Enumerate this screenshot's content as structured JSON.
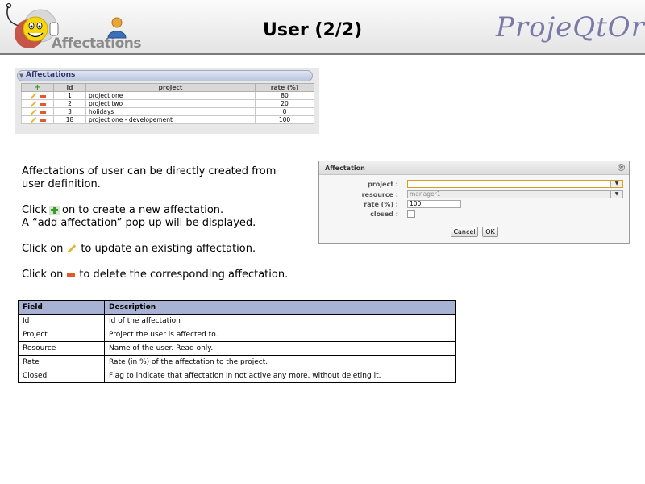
{
  "header": {
    "icon_label": "Affectations",
    "title": "User (2/2)",
    "brand": "ProjeQtOr"
  },
  "affectations_panel": {
    "title": "Affectations",
    "columns": [
      "id",
      "project",
      "rate (%)"
    ],
    "rows": [
      {
        "id": "1",
        "project": "project one",
        "rate": "80"
      },
      {
        "id": "2",
        "project": "project two",
        "rate": "20"
      },
      {
        "id": "3",
        "project": "holidays",
        "rate": "0"
      },
      {
        "id": "18",
        "project": "project one - developement",
        "rate": "100"
      }
    ]
  },
  "description": {
    "line1": "Affectations of user can be directly created from",
    "line2": "user definition.",
    "click_add_pre": "Click",
    "click_add_post": "on to create a new affectation.",
    "popup_line": "A “add affectation” pop up will be displayed.",
    "click_update_pre": "Click on",
    "click_update_post": "to update an existing affectation.",
    "click_delete_pre": "Click on",
    "click_delete_post": "to delete the corresponding affectation."
  },
  "dialog": {
    "title": "Affectation",
    "close_symbol": "⊗",
    "project_label": "project :",
    "project_value": "",
    "resource_label": "resource :",
    "resource_value": "manager1",
    "rate_label": "rate (%) :",
    "rate_value": "100",
    "closed_label": "closed :",
    "cancel_label": "Cancel",
    "ok_label": "OK"
  },
  "fields_table": {
    "header_field": "Field",
    "header_description": "Description",
    "rows": [
      {
        "field": "Id",
        "description": "Id of the affectation"
      },
      {
        "field": "Project",
        "description": "Project the user is affected to."
      },
      {
        "field": "Resource",
        "description": "Name of the user. Read only."
      },
      {
        "field": "Rate",
        "description": "Rate (in %) of the affectation to the project."
      },
      {
        "field": "Closed",
        "description": "Flag to indicate that affectation in not active any more, without deleting it."
      }
    ]
  },
  "icons": {
    "logo": "smiley-logo-icon",
    "user": "user-icon",
    "add": "plus-icon",
    "edit": "pencil-icon",
    "delete": "minus-icon"
  },
  "colors": {
    "brand": "#7a7aa8",
    "table_header": "#a8b2d4",
    "add_green": "#3a9a2a",
    "delete_red": "#e25a2a",
    "edit_yellow": "#e2b83b"
  }
}
